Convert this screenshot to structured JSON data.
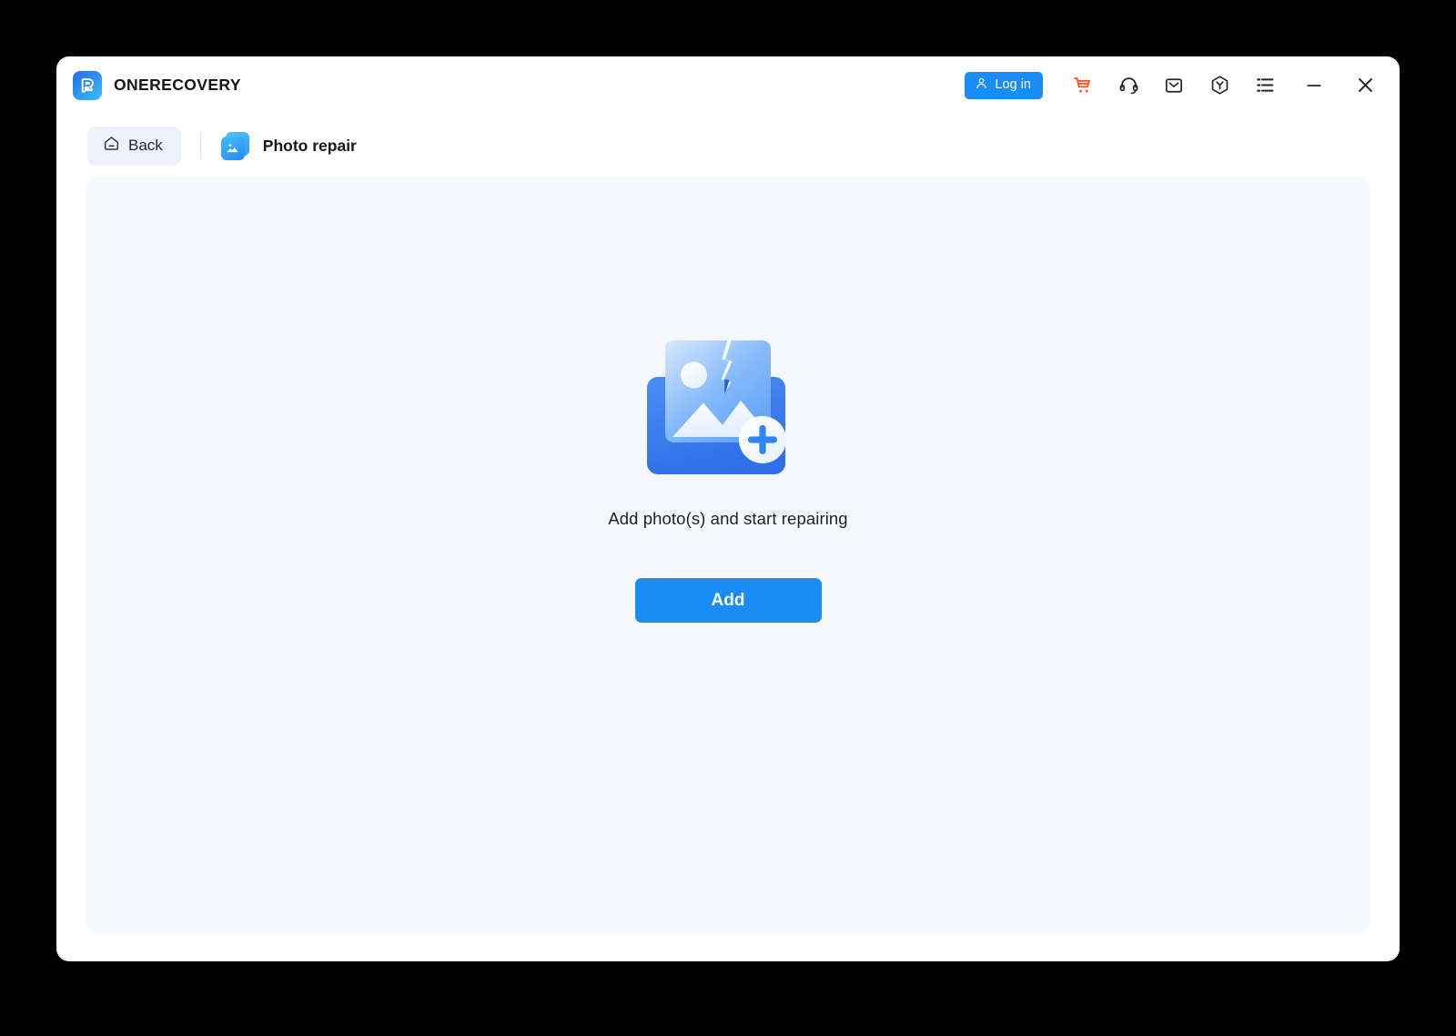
{
  "window": {
    "app_name": "ONERECOVERY",
    "logo_icon": "onerecovery-logo-icon",
    "brand_color": "#2f8ef2"
  },
  "titlebar": {
    "login": {
      "label": "Log in",
      "icon": "user-icon",
      "color": "#1a8cf5"
    },
    "icons": [
      {
        "name": "cart-icon",
        "title": "Cart",
        "color": "#f4511e"
      },
      {
        "name": "headset-icon",
        "title": "Support",
        "color": "#21262e"
      },
      {
        "name": "mail-icon",
        "title": "Mail",
        "color": "#21262e"
      },
      {
        "name": "box-icon",
        "title": "Products",
        "color": "#21262e"
      },
      {
        "name": "list-icon",
        "title": "Menu",
        "color": "#21262e"
      }
    ],
    "window_controls": [
      {
        "name": "minimize-button",
        "glyph": "—"
      },
      {
        "name": "close-button",
        "glyph": "✕"
      }
    ]
  },
  "toolbar": {
    "back": {
      "label": "Back",
      "icon": "home-icon"
    },
    "page": {
      "title": "Photo repair",
      "icon": "photo-repair-icon"
    }
  },
  "main": {
    "illustration": "broken-photo-add-illustration",
    "prompt": "Add photo(s) and start repairing",
    "add_button": {
      "label": "Add",
      "color": "#1a8cf5"
    },
    "panel_color": "#f5f8fd"
  }
}
